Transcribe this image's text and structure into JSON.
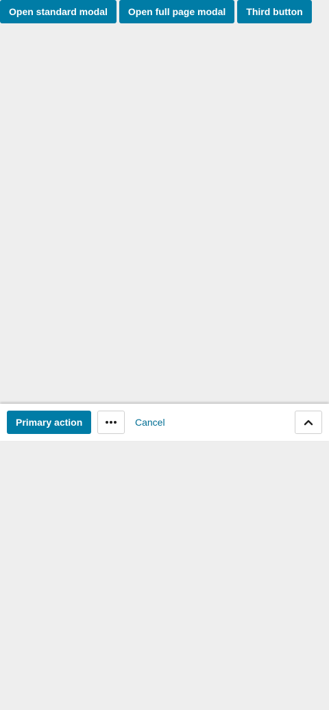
{
  "toolbar": {
    "buttons": [
      {
        "label": "Open standard modal"
      },
      {
        "label": "Open full page modal"
      },
      {
        "label": "Third button"
      }
    ]
  },
  "action_bar": {
    "primary_label": "Primary action",
    "more_icon": "ellipsis-icon",
    "cancel_label": "Cancel",
    "collapse_icon": "chevron-up-icon"
  },
  "colors": {
    "accent": "#007ca6",
    "link": "#006e94",
    "background": "#eeeeee",
    "bar_background": "#ffffff"
  }
}
